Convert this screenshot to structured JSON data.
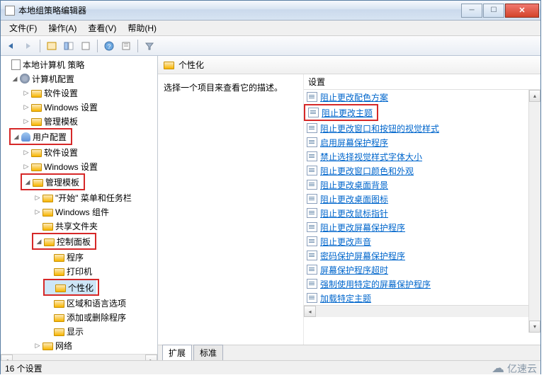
{
  "title": "本地组策略编辑器",
  "menu": {
    "file": "文件(F)",
    "action": "操作(A)",
    "view": "查看(V)",
    "help": "帮助(H)"
  },
  "tree": {
    "root": "本地计算机 策略",
    "comp": "计算机配置",
    "sw": "软件设置",
    "win": "Windows 设置",
    "admin": "管理模板",
    "user": "用户配置",
    "start": "\"开始\" 菜单和任务栏",
    "wincomp": "Windows 组件",
    "shared": "共享文件夹",
    "cpl": "控制面板",
    "prog": "程序",
    "printer": "打印机",
    "pers": "个性化",
    "region": "区域和语言选项",
    "addrem": "添加或删除程序",
    "display": "显示",
    "network": "网络"
  },
  "header": "个性化",
  "desc_prompt": "选择一个项目来查看它的描述。",
  "settings_label": "设置",
  "settings": [
    "阻止更改配色方案",
    "阻止更改主题",
    "阻止更改窗口和按钮的视觉样式",
    "启用屏幕保护程序",
    "禁止选择视觉样式字体大小",
    "阻止更改窗口颜色和外观",
    "阻止更改桌面背景",
    "阻止更改桌面图标",
    "阻止更改鼠标指针",
    "阻止更改屏幕保护程序",
    "阻止更改声音",
    "密码保护屏幕保护程序",
    "屏幕保护程序超时",
    "强制使用特定的屏幕保护程序",
    "加载特定主题"
  ],
  "highlighted_setting_index": 1,
  "tabs": {
    "ext": "扩展",
    "std": "标准"
  },
  "status": "16 个设置",
  "watermark": "亿速云"
}
